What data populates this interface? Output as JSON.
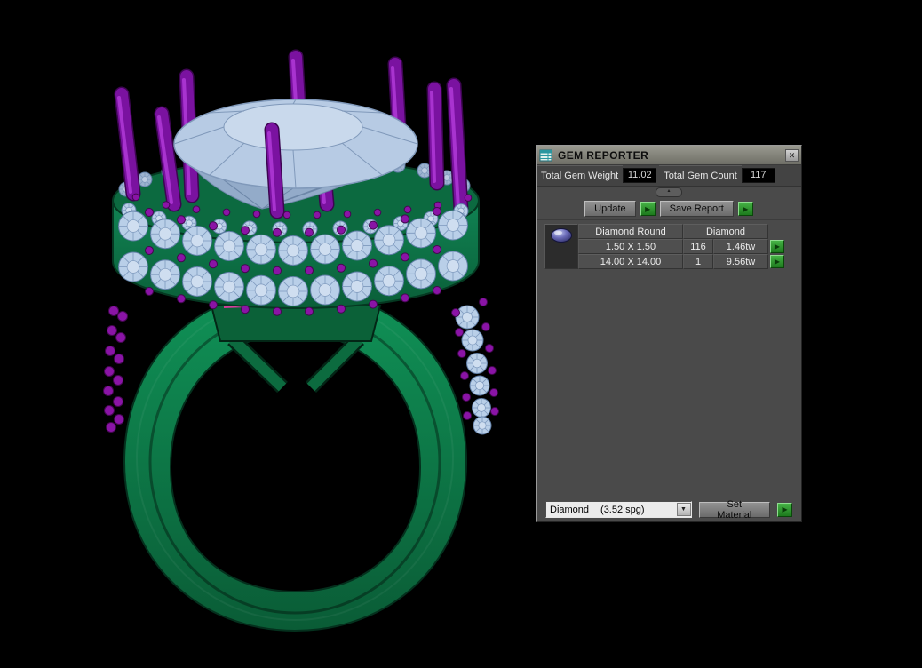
{
  "panel": {
    "title": "GEM REPORTER",
    "close_glyph": "✕",
    "stats": {
      "weight_label": "Total Gem Weight",
      "weight_value": "11.02",
      "count_label": "Total Gem Count",
      "count_value": "117"
    },
    "collapse_glyph": "▴",
    "buttons": {
      "update": "Update",
      "save_report": "Save Report",
      "set_material": "Set Material",
      "run_glyph": "▶"
    },
    "table": {
      "gem_name": "Diamond Round",
      "gem_material": "Diamond",
      "rows": [
        {
          "size": "1.50 X 1.50",
          "count": "116",
          "weight": "1.46tw"
        },
        {
          "size": "14.00 X 14.00",
          "count": "1",
          "weight": "9.56tw"
        }
      ]
    },
    "material": {
      "name": "Diamond",
      "density": "(3.52 spg)",
      "dropdown_glyph": "▼"
    }
  }
}
